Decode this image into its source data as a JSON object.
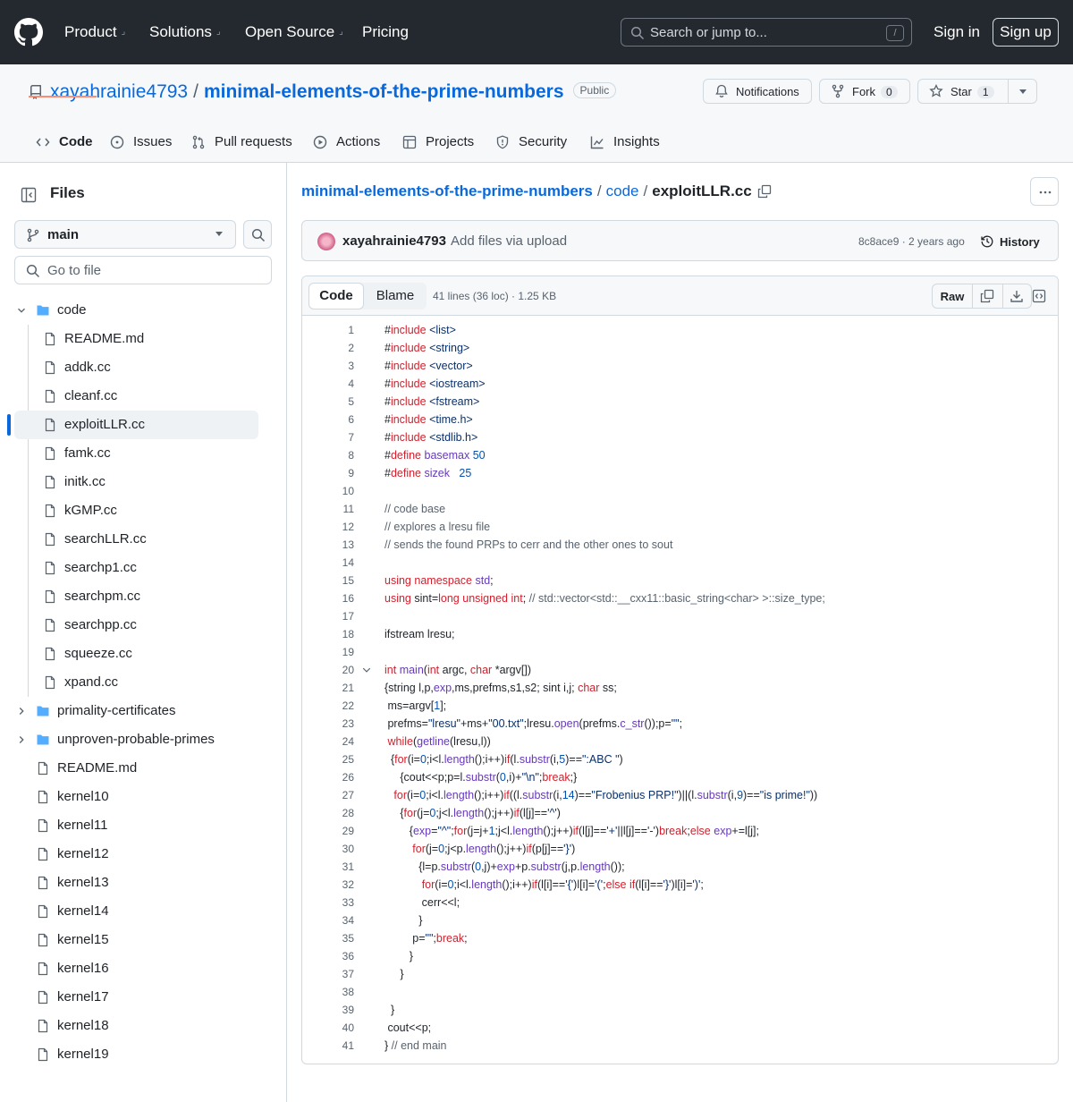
{
  "header": {
    "nav": [
      {
        "label": "Product",
        "caret": true
      },
      {
        "label": "Solutions",
        "caret": true
      },
      {
        "label": "Open Source",
        "caret": true
      },
      {
        "label": "Pricing",
        "caret": false
      }
    ],
    "search_placeholder": "Search or jump to...",
    "search_shortcut": "/",
    "sign_in": "Sign in",
    "sign_up": "Sign up"
  },
  "repo": {
    "owner": "xayahrainie4793",
    "separator": "/",
    "name": "minimal-elements-of-the-prime-numbers",
    "visibility": "Public",
    "notifications_label": "Notifications",
    "fork_label": "Fork",
    "fork_count": "0",
    "star_label": "Star",
    "star_count": "1"
  },
  "tabs": [
    {
      "label": "Code",
      "icon": "code-icon",
      "selected": true
    },
    {
      "label": "Issues",
      "icon": "issue-icon",
      "selected": false
    },
    {
      "label": "Pull requests",
      "icon": "pull-request-icon",
      "selected": false
    },
    {
      "label": "Actions",
      "icon": "play-icon",
      "selected": false
    },
    {
      "label": "Projects",
      "icon": "table-icon",
      "selected": false
    },
    {
      "label": "Security",
      "icon": "shield-icon",
      "selected": false
    },
    {
      "label": "Insights",
      "icon": "graph-icon",
      "selected": false
    }
  ],
  "sidebar": {
    "title": "Files",
    "branch": "main",
    "go_to_file": "Go to file",
    "tree": [
      {
        "label": "code",
        "type": "folder",
        "depth": 0,
        "expanded": true
      },
      {
        "label": "README.md",
        "type": "file",
        "depth": 1
      },
      {
        "label": "addk.cc",
        "type": "file",
        "depth": 1
      },
      {
        "label": "cleanf.cc",
        "type": "file",
        "depth": 1
      },
      {
        "label": "exploitLLR.cc",
        "type": "file",
        "depth": 1,
        "selected": true
      },
      {
        "label": "famk.cc",
        "type": "file",
        "depth": 1
      },
      {
        "label": "initk.cc",
        "type": "file",
        "depth": 1
      },
      {
        "label": "kGMP.cc",
        "type": "file",
        "depth": 1
      },
      {
        "label": "searchLLR.cc",
        "type": "file",
        "depth": 1
      },
      {
        "label": "searchp1.cc",
        "type": "file",
        "depth": 1
      },
      {
        "label": "searchpm.cc",
        "type": "file",
        "depth": 1
      },
      {
        "label": "searchpp.cc",
        "type": "file",
        "depth": 1
      },
      {
        "label": "squeeze.cc",
        "type": "file",
        "depth": 1
      },
      {
        "label": "xpand.cc",
        "type": "file",
        "depth": 1
      },
      {
        "label": "primality-certificates",
        "type": "folder",
        "depth": 0,
        "expanded": false
      },
      {
        "label": "unproven-probable-primes",
        "type": "folder",
        "depth": 0,
        "expanded": false
      },
      {
        "label": "README.md",
        "type": "file",
        "depth": 0
      },
      {
        "label": "kernel10",
        "type": "file",
        "depth": 0
      },
      {
        "label": "kernel11",
        "type": "file",
        "depth": 0
      },
      {
        "label": "kernel12",
        "type": "file",
        "depth": 0
      },
      {
        "label": "kernel13",
        "type": "file",
        "depth": 0
      },
      {
        "label": "kernel14",
        "type": "file",
        "depth": 0
      },
      {
        "label": "kernel15",
        "type": "file",
        "depth": 0
      },
      {
        "label": "kernel16",
        "type": "file",
        "depth": 0
      },
      {
        "label": "kernel17",
        "type": "file",
        "depth": 0
      },
      {
        "label": "kernel18",
        "type": "file",
        "depth": 0
      },
      {
        "label": "kernel19",
        "type": "file",
        "depth": 0
      }
    ]
  },
  "breadcrumb": {
    "repo": "minimal-elements-of-the-prime-numbers",
    "folder": "code",
    "file": "exploitLLR.cc",
    "sep": "/"
  },
  "commit": {
    "author": "xayahrainie4793",
    "message": "Add files via upload",
    "sha_time": "8c8ace9 · 2 years ago",
    "history": "History"
  },
  "file": {
    "view_code": "Code",
    "view_blame": "Blame",
    "meta": "41 lines (36 loc) · 1.25 KB",
    "raw": "Raw"
  },
  "code_lines": [
    "#include <list>",
    "#include <string>",
    "#include <vector>",
    "#include <iostream>",
    "#include <fstream>",
    "#include <time.h>",
    "#include <stdlib.h>",
    "#define basemax 50",
    "#define sizek   25",
    "",
    "// code base",
    "// explores a lresu file",
    "// sends the found PRPs to cerr and the other ones to sout",
    "",
    "using namespace std;",
    "using sint=long unsigned int; // std::vector<std::__cxx11::basic_string<char> >::size_type;",
    "",
    "ifstream lresu;",
    "",
    "int main(int argc, char *argv[])",
    "{string l,p,exp,ms,prefms,s1,s2; sint i,j; char ss;",
    " ms=argv[1];",
    " prefms=\"lresu\"+ms+\"00.txt\";lresu.open(prefms.c_str());p=\"\";",
    " while(getline(lresu,l))",
    "  {for(i=0;i<l.length();i++)if(l.substr(i,5)==\":ABC \")",
    "     {cout<<p;p=l.substr(0,i)+\"\\n\";break;}",
    "   for(i=0;i<l.length();i++)if((l.substr(i,14)==\"Frobenius PRP!\")||(l.substr(i,9)==\"is prime!\"))",
    "     {for(j=0;j<l.length();j++)if(l[j]=='^')",
    "        {exp=\"^\";for(j=j+1;j<l.length();j++)if(l[j]=='+'||l[j]=='-')break;else exp+=l[j];",
    "         for(j=0;j<p.length();j++)if(p[j]=='}')",
    "           {l=p.substr(0,j)+exp+p.substr(j,p.length());",
    "            for(i=0;i<l.length();i++)if(l[i]=='{')l[i]='(';else if(l[i]=='}')l[i]=')';",
    "            cerr<<l;",
    "           }",
    "         p=\"\";break;",
    "        }",
    "     }",
    "",
    "  }",
    " cout<<p;",
    "} // end main"
  ],
  "fold_line": 20
}
